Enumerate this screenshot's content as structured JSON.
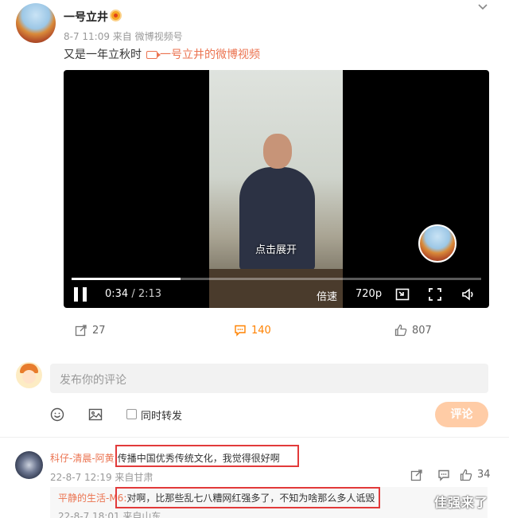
{
  "post": {
    "author": "一号立井",
    "meta": "8-7 11:09  来自 微博视频号",
    "text": "又是一年立秋时",
    "link_text": "一号立井的微博视频"
  },
  "video": {
    "subtitle": "点击展开",
    "current_time": "0:34",
    "separator": " / ",
    "duration": "2:13",
    "speed_label": "倍速",
    "quality_label": "720p",
    "progress": 0.266
  },
  "actions": {
    "repost_count": "27",
    "comment_count": "140",
    "like_count": "807"
  },
  "composer": {
    "placeholder": "发布你的评论",
    "forward_label": "同时转发",
    "submit_label": "评论"
  },
  "comments": [
    {
      "user": "科仔-清晨-阿黄:",
      "text": "传播中国优秀传统文化，我觉得很好啊",
      "meta": "22-8-7 12:19  来自甘肃",
      "like_count": "34",
      "reply": {
        "user": "平静的生活-M6:",
        "text": "对啊，比那些乱七八糟网红强多了，不知为啥那么多人诋毁",
        "meta": "22-8-7 18:01  来自山东"
      }
    }
  ],
  "watermark": "佳强来了",
  "colors": {
    "accent": "#eb7350",
    "active": "#ff8200",
    "highlight_box": "#e23a3a"
  }
}
